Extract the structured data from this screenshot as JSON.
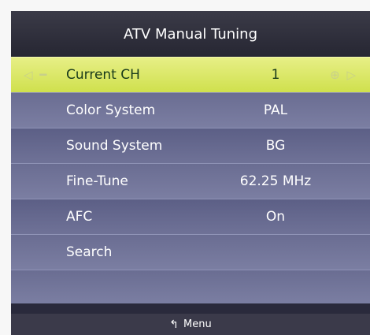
{
  "title": "ATV Manual Tuning",
  "rows": [
    {
      "label": "Current CH",
      "value": "1"
    },
    {
      "label": "Color System",
      "value": "PAL"
    },
    {
      "label": "Sound System",
      "value": "BG"
    },
    {
      "label": "Fine-Tune",
      "value": "62.25 MHz"
    },
    {
      "label": "AFC",
      "value": "On"
    },
    {
      "label": "Search",
      "value": ""
    }
  ],
  "selected_arrows": {
    "left": "◁ ━",
    "right": "⊕ ▷"
  },
  "footer": {
    "icon": "↰",
    "label": "Menu"
  },
  "colors": {
    "selected": "#d8e66a",
    "row": "#6a6d92",
    "title": "#30303e"
  }
}
